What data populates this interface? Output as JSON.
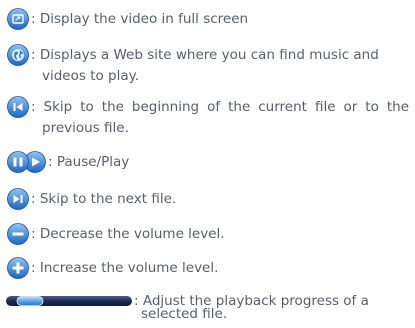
{
  "items": [
    {
      "icon": "fullscreen-icon",
      "text": ": Display the video in full screen"
    },
    {
      "icon": "globe-icon",
      "line1": ": Displays a Web site where you can find music and",
      "line2": "videos to play."
    },
    {
      "icon": "skip-back-icon",
      "line1": ": Skip to the beginning of the current file or to the",
      "line2": "previous file."
    },
    {
      "icon": "pause-play-icon",
      "text": ": Pause/Play"
    },
    {
      "icon": "skip-next-icon",
      "text": ": Skip to the next file."
    },
    {
      "icon": "volume-decrease-icon",
      "text": ": Decrease the volume level."
    },
    {
      "icon": "volume-increase-icon",
      "text": ": Increase the volume level."
    },
    {
      "icon": "progress-slider-icon",
      "line1": ": Adjust the playback progress of a",
      "line2": "selected file."
    }
  ],
  "colors": {
    "text": "#55606b",
    "icon_blue": "#1f66c2",
    "icon_blue_light": "#6fb0ee",
    "slider_dark": "#1c2c52"
  }
}
